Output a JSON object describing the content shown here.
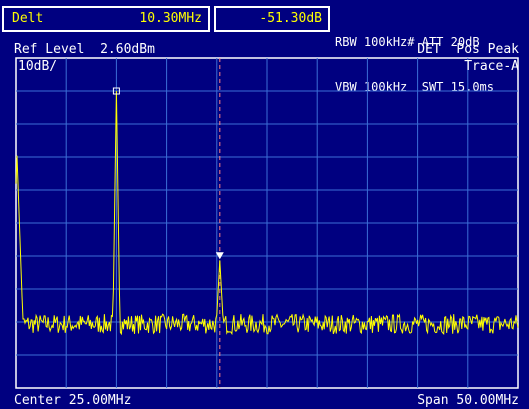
{
  "marker": {
    "mode": "Delt",
    "frequency": "10.30MHz",
    "level": "-51.30dB"
  },
  "settings": {
    "rbw_label": "RBW",
    "rbw_value": "100kHz#",
    "att_label": "ATT",
    "att_value": "20dB",
    "vbw_label": "VBW",
    "vbw_value": "100kHz",
    "swt_label": "SWT",
    "swt_value": "15.0ms"
  },
  "display": {
    "ref_level_label": "Ref Level",
    "ref_level_value": "2.60dBm",
    "det_label": "DET",
    "det_value": "Pos Peak",
    "scale": "10dB/",
    "trace": "Trace-A",
    "center_label": "Center",
    "center_value": "25.00MHz",
    "span_label": "Span",
    "span_value": "50.00MHz"
  },
  "colors": {
    "background": "#000080",
    "grid": "#3b6ed6",
    "trace": "#ffff00",
    "text": "#ffffff",
    "marker_line": "#ff8080"
  },
  "chart_data": {
    "type": "line",
    "title": "",
    "xlabel": "",
    "ylabel": "",
    "x_range_mhz": [
      0,
      50
    ],
    "y_range_dbm": [
      -97.4,
      2.6
    ],
    "grid": true,
    "noise_floor_dbm": -78,
    "noise_spread_db": 3,
    "peaks": [
      {
        "freq_mhz": 0.1,
        "level_dbm": -27
      },
      {
        "freq_mhz": 10.0,
        "level_dbm": -7.4,
        "marker": "reference"
      },
      {
        "freq_mhz": 20.3,
        "level_dbm": -58.7,
        "marker": "delta"
      }
    ],
    "delta_marker_freq_mhz": 20.3
  }
}
